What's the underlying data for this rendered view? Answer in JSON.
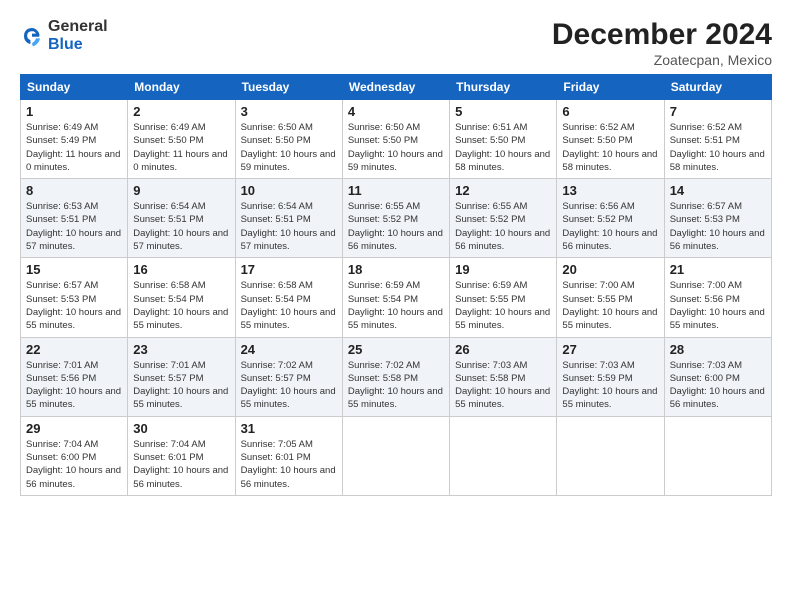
{
  "logo": {
    "general": "General",
    "blue": "Blue"
  },
  "title": "December 2024",
  "location": "Zoatecpan, Mexico",
  "weekdays": [
    "Sunday",
    "Monday",
    "Tuesday",
    "Wednesday",
    "Thursday",
    "Friday",
    "Saturday"
  ],
  "weeks": [
    [
      {
        "day": "1",
        "sunrise": "6:49 AM",
        "sunset": "5:49 PM",
        "daylight": "11 hours and 0 minutes."
      },
      {
        "day": "2",
        "sunrise": "6:49 AM",
        "sunset": "5:50 PM",
        "daylight": "11 hours and 0 minutes."
      },
      {
        "day": "3",
        "sunrise": "6:50 AM",
        "sunset": "5:50 PM",
        "daylight": "10 hours and 59 minutes."
      },
      {
        "day": "4",
        "sunrise": "6:50 AM",
        "sunset": "5:50 PM",
        "daylight": "10 hours and 59 minutes."
      },
      {
        "day": "5",
        "sunrise": "6:51 AM",
        "sunset": "5:50 PM",
        "daylight": "10 hours and 58 minutes."
      },
      {
        "day": "6",
        "sunrise": "6:52 AM",
        "sunset": "5:50 PM",
        "daylight": "10 hours and 58 minutes."
      },
      {
        "day": "7",
        "sunrise": "6:52 AM",
        "sunset": "5:51 PM",
        "daylight": "10 hours and 58 minutes."
      }
    ],
    [
      {
        "day": "8",
        "sunrise": "6:53 AM",
        "sunset": "5:51 PM",
        "daylight": "10 hours and 57 minutes."
      },
      {
        "day": "9",
        "sunrise": "6:54 AM",
        "sunset": "5:51 PM",
        "daylight": "10 hours and 57 minutes."
      },
      {
        "day": "10",
        "sunrise": "6:54 AM",
        "sunset": "5:51 PM",
        "daylight": "10 hours and 57 minutes."
      },
      {
        "day": "11",
        "sunrise": "6:55 AM",
        "sunset": "5:52 PM",
        "daylight": "10 hours and 56 minutes."
      },
      {
        "day": "12",
        "sunrise": "6:55 AM",
        "sunset": "5:52 PM",
        "daylight": "10 hours and 56 minutes."
      },
      {
        "day": "13",
        "sunrise": "6:56 AM",
        "sunset": "5:52 PM",
        "daylight": "10 hours and 56 minutes."
      },
      {
        "day": "14",
        "sunrise": "6:57 AM",
        "sunset": "5:53 PM",
        "daylight": "10 hours and 56 minutes."
      }
    ],
    [
      {
        "day": "15",
        "sunrise": "6:57 AM",
        "sunset": "5:53 PM",
        "daylight": "10 hours and 55 minutes."
      },
      {
        "day": "16",
        "sunrise": "6:58 AM",
        "sunset": "5:54 PM",
        "daylight": "10 hours and 55 minutes."
      },
      {
        "day": "17",
        "sunrise": "6:58 AM",
        "sunset": "5:54 PM",
        "daylight": "10 hours and 55 minutes."
      },
      {
        "day": "18",
        "sunrise": "6:59 AM",
        "sunset": "5:54 PM",
        "daylight": "10 hours and 55 minutes."
      },
      {
        "day": "19",
        "sunrise": "6:59 AM",
        "sunset": "5:55 PM",
        "daylight": "10 hours and 55 minutes."
      },
      {
        "day": "20",
        "sunrise": "7:00 AM",
        "sunset": "5:55 PM",
        "daylight": "10 hours and 55 minutes."
      },
      {
        "day": "21",
        "sunrise": "7:00 AM",
        "sunset": "5:56 PM",
        "daylight": "10 hours and 55 minutes."
      }
    ],
    [
      {
        "day": "22",
        "sunrise": "7:01 AM",
        "sunset": "5:56 PM",
        "daylight": "10 hours and 55 minutes."
      },
      {
        "day": "23",
        "sunrise": "7:01 AM",
        "sunset": "5:57 PM",
        "daylight": "10 hours and 55 minutes."
      },
      {
        "day": "24",
        "sunrise": "7:02 AM",
        "sunset": "5:57 PM",
        "daylight": "10 hours and 55 minutes."
      },
      {
        "day": "25",
        "sunrise": "7:02 AM",
        "sunset": "5:58 PM",
        "daylight": "10 hours and 55 minutes."
      },
      {
        "day": "26",
        "sunrise": "7:03 AM",
        "sunset": "5:58 PM",
        "daylight": "10 hours and 55 minutes."
      },
      {
        "day": "27",
        "sunrise": "7:03 AM",
        "sunset": "5:59 PM",
        "daylight": "10 hours and 55 minutes."
      },
      {
        "day": "28",
        "sunrise": "7:03 AM",
        "sunset": "6:00 PM",
        "daylight": "10 hours and 56 minutes."
      }
    ],
    [
      {
        "day": "29",
        "sunrise": "7:04 AM",
        "sunset": "6:00 PM",
        "daylight": "10 hours and 56 minutes."
      },
      {
        "day": "30",
        "sunrise": "7:04 AM",
        "sunset": "6:01 PM",
        "daylight": "10 hours and 56 minutes."
      },
      {
        "day": "31",
        "sunrise": "7:05 AM",
        "sunset": "6:01 PM",
        "daylight": "10 hours and 56 minutes."
      },
      null,
      null,
      null,
      null
    ]
  ]
}
